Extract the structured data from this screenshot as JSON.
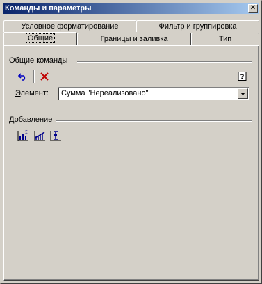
{
  "window": {
    "title": "Команды и параметры",
    "close_icon": "close-icon"
  },
  "tabs": {
    "row_back": [
      {
        "label": "Условное форматирование"
      },
      {
        "label": "Фильтр и группировка"
      }
    ],
    "row_front": [
      {
        "label": "Общие",
        "active": true
      },
      {
        "label": "Границы и заливка"
      },
      {
        "label": "Тип"
      }
    ]
  },
  "general": {
    "heading": "Общие команды",
    "toolbar": [
      {
        "icon": "undo-icon"
      },
      {
        "icon": "delete-icon"
      },
      {
        "icon": "help-icon"
      }
    ],
    "element_label": "Элемент:",
    "element_label_mnemonic": "Э",
    "element_label_rest": "лемент:",
    "element_value": "Сумма \"Нереализовано\""
  },
  "add": {
    "heading": "Добавление",
    "toolbar": [
      {
        "icon": "add-totals-icon"
      },
      {
        "icon": "add-trendline-icon"
      },
      {
        "icon": "add-error-bars-icon"
      }
    ]
  },
  "colors": {
    "title_start": "#0a246a",
    "title_end": "#a6caf0",
    "face": "#d4d0c8"
  }
}
